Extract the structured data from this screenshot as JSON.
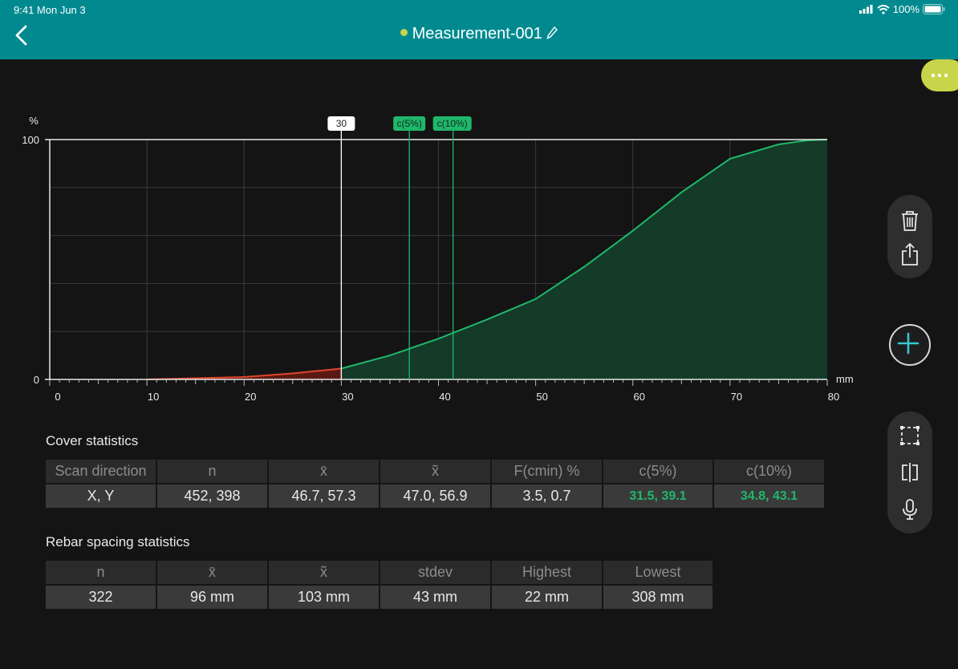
{
  "status_bar": {
    "time": "9:41  Mon Jun 3",
    "battery": "100%"
  },
  "header": {
    "title": "Measurement-001"
  },
  "chart_data": {
    "type": "area",
    "y_unit": "%",
    "x_unit": "mm",
    "xlim": [
      0,
      80
    ],
    "ylim": [
      0,
      100
    ],
    "x_ticks": [
      "0",
      "10",
      "20",
      "30",
      "40",
      "50",
      "60",
      "70",
      "80"
    ],
    "y_ticks": [
      "0",
      "100"
    ],
    "grid": true,
    "cmin_marker": {
      "label": "30",
      "x": 30
    },
    "c5_marker": {
      "label": "c(5%)",
      "x": 37
    },
    "c10_marker": {
      "label": "c(10%)",
      "x": 41.5
    },
    "series": [
      {
        "x": [
          10,
          15,
          20,
          25,
          30,
          35,
          40,
          45,
          50,
          55,
          60,
          65,
          70,
          75,
          78,
          80
        ],
        "values": [
          0,
          0.5,
          1,
          2.5,
          4.5,
          10,
          17,
          25,
          33.5,
          47,
          62,
          78,
          92,
          98,
          99.7,
          100
        ]
      }
    ],
    "colors": {
      "below_cmin": "#e0462e",
      "above_cmin": "#1fb86a",
      "fill": "#143a28"
    }
  },
  "cover": {
    "title": "Cover statistics",
    "headers": [
      "Scan direction",
      "n",
      "x̄",
      "x̃",
      "F(cmin) %",
      "c(5%)",
      "c(10%)"
    ],
    "row": [
      "X, Y",
      "452, 398",
      "46.7, 57.3",
      "47.0, 56.9",
      "3.5, 0.7",
      "31.5, 39.1",
      "34.8, 43.1"
    ]
  },
  "rebar": {
    "title": "Rebar spacing statistics",
    "headers": [
      "n",
      "x̄",
      "x̃",
      "stdev",
      "Highest",
      "Lowest"
    ],
    "row": [
      "322",
      "96 mm",
      "103 mm",
      "43 mm",
      "22 mm",
      "308 mm"
    ]
  },
  "icons": [
    "back-chevron-icon",
    "edit-pencil-icon",
    "more-icon",
    "trash-icon",
    "share-icon",
    "add-icon",
    "selection-icon",
    "split-view-icon",
    "microphone-icon"
  ]
}
